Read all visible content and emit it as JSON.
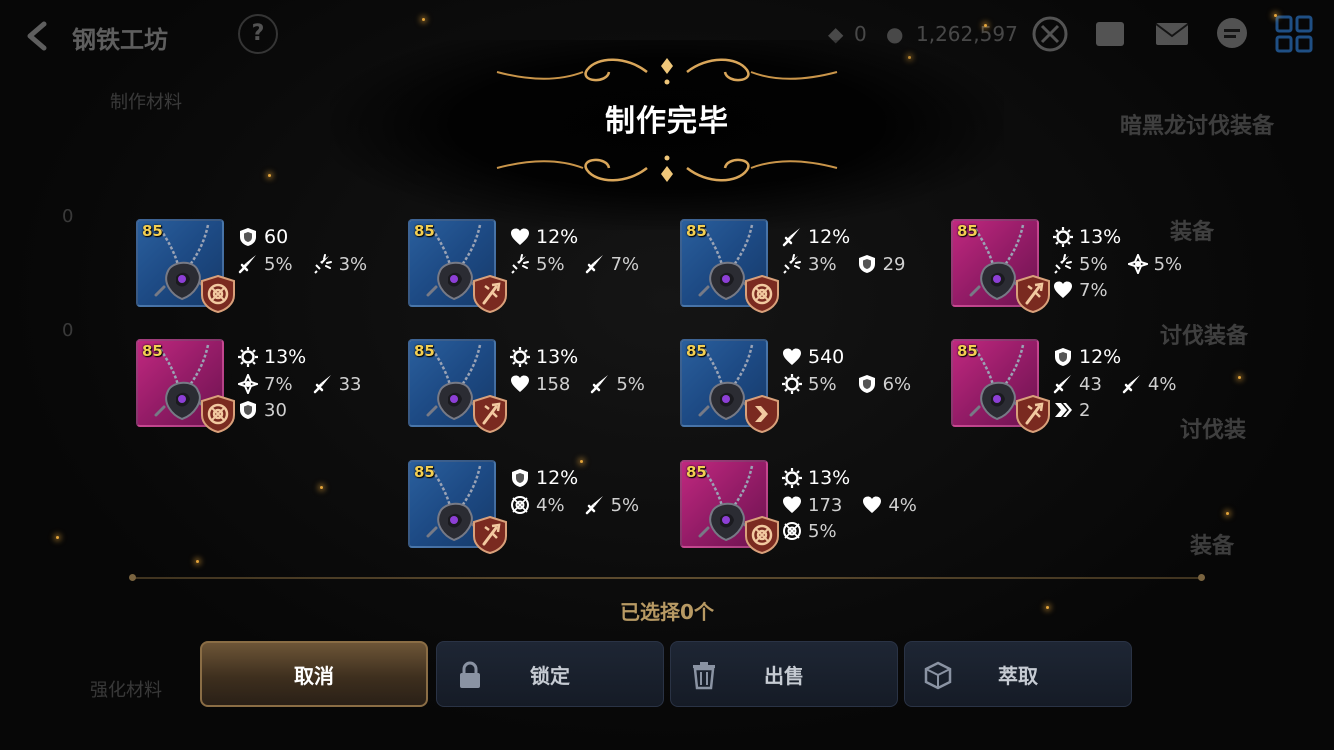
{
  "header": {
    "title": "钢铁工坊",
    "currency_1": "0",
    "currency_2": "1,262,597"
  },
  "background_text": {
    "right_1": "暗黑龙讨伐装备",
    "right_2": "装备",
    "right_3": "讨伐装备",
    "right_4": "讨伐装",
    "right_5": "装备",
    "left_1": "制作材料",
    "left_2": "0",
    "left_3": "0",
    "left_4": "强化材料"
  },
  "modal": {
    "title": "制作完毕",
    "selected_text": "已选择0个",
    "buttons": {
      "cancel": "取消",
      "lock": "锁定",
      "sell": "出售",
      "extract": "萃取"
    }
  },
  "items": [
    {
      "level": "85",
      "rarity": "blue",
      "badge": "target",
      "main": {
        "icon": "shield-icon",
        "value": "60"
      },
      "subs": [
        {
          "icon": "sword-icon",
          "value": "5%"
        },
        {
          "icon": "crit-icon",
          "value": "3%"
        }
      ]
    },
    {
      "level": "85",
      "rarity": "blue",
      "badge": "trident",
      "main": {
        "icon": "heart-icon",
        "value": "12%"
      },
      "subs": [
        {
          "icon": "crit-icon",
          "value": "5%"
        },
        {
          "icon": "sword-icon",
          "value": "7%"
        }
      ]
    },
    {
      "level": "85",
      "rarity": "blue",
      "badge": "target",
      "main": {
        "icon": "sword-icon",
        "value": "12%"
      },
      "subs": [
        {
          "icon": "crit-icon",
          "value": "3%"
        },
        {
          "icon": "shield-icon",
          "value": "29"
        }
      ]
    },
    {
      "level": "85",
      "rarity": "magenta",
      "badge": "trident",
      "main": {
        "icon": "burst-icon",
        "value": "13%"
      },
      "subs": [
        {
          "icon": "crit-icon",
          "value": "5%"
        },
        {
          "icon": "resist-icon",
          "value": "5%"
        },
        {
          "icon": "heart-icon",
          "value": "7%"
        }
      ]
    },
    {
      "level": "85",
      "rarity": "magenta",
      "badge": "target",
      "main": {
        "icon": "burst-icon",
        "value": "13%"
      },
      "subs": [
        {
          "icon": "resist-icon",
          "value": "7%"
        },
        {
          "icon": "sword-icon",
          "value": "33"
        },
        {
          "icon": "shield-icon",
          "value": "30"
        }
      ]
    },
    {
      "level": "85",
      "rarity": "blue",
      "badge": "trident",
      "main": {
        "icon": "burst-icon",
        "value": "13%"
      },
      "subs": [
        {
          "icon": "heart-icon",
          "value": "158"
        },
        {
          "icon": "sword-icon",
          "value": "5%"
        }
      ]
    },
    {
      "level": "85",
      "rarity": "blue",
      "badge": "arrow",
      "main": {
        "icon": "heart-icon",
        "value": "540"
      },
      "subs": [
        {
          "icon": "burst-icon",
          "value": "5%"
        },
        {
          "icon": "shield-icon",
          "value": "6%"
        }
      ]
    },
    {
      "level": "85",
      "rarity": "magenta",
      "badge": "trident",
      "main": {
        "icon": "shield-icon",
        "value": "12%"
      },
      "subs": [
        {
          "icon": "sword-icon",
          "value": "43"
        },
        {
          "icon": "sword-icon",
          "value": "4%"
        },
        {
          "icon": "speed-icon",
          "value": "2"
        }
      ]
    },
    {
      "level": "85",
      "rarity": "blue",
      "badge": "trident",
      "main": {
        "icon": "shield-icon",
        "value": "12%"
      },
      "subs": [
        {
          "icon": "target-icon",
          "value": "4%"
        },
        {
          "icon": "sword-icon",
          "value": "5%"
        }
      ]
    },
    {
      "level": "85",
      "rarity": "magenta",
      "badge": "target",
      "main": {
        "icon": "burst-icon",
        "value": "13%"
      },
      "subs": [
        {
          "icon": "heart-icon",
          "value": "173"
        },
        {
          "icon": "heart-icon",
          "value": "4%"
        },
        {
          "icon": "target-icon",
          "value": "5%"
        }
      ]
    }
  ],
  "colors": {
    "gold_text": "#b89a64",
    "level_text": "#f3cf52",
    "blue_card": "#1d4a84",
    "magenta_card": "#941c67"
  }
}
